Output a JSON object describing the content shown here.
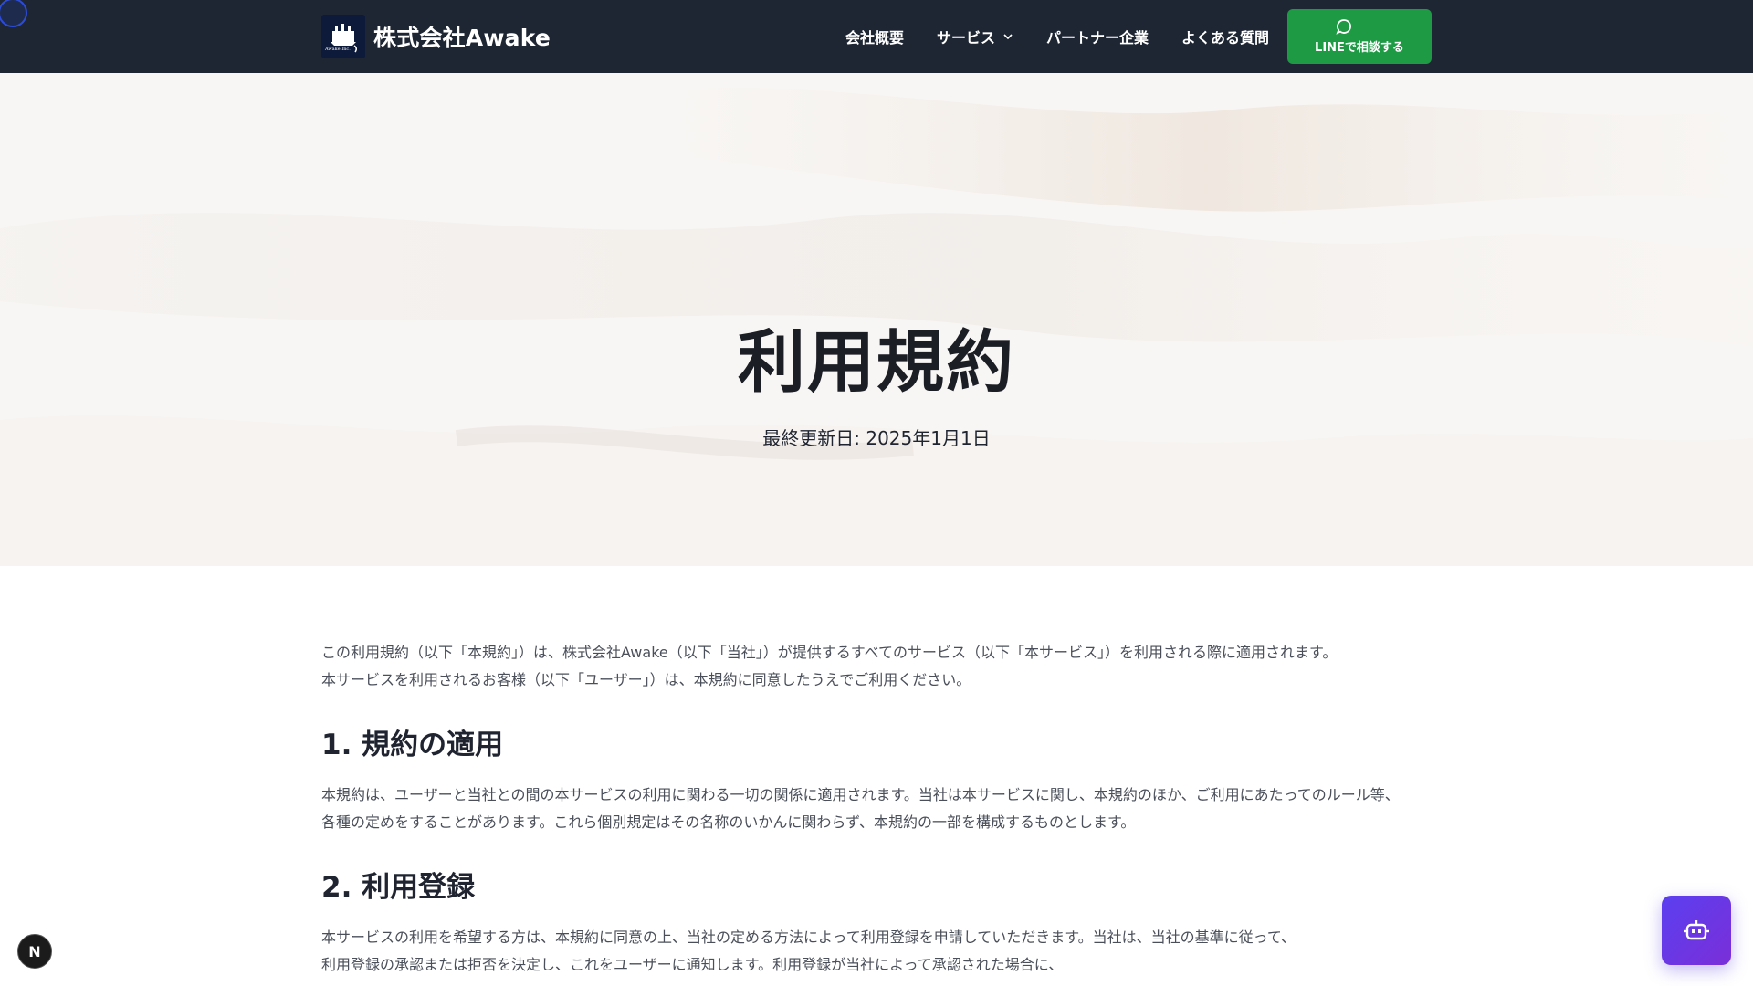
{
  "header": {
    "brand_name": "株式会社Awake",
    "logo_text": "Awake Inc.",
    "nav": [
      {
        "label": "会社概要"
      },
      {
        "label": "サービス"
      },
      {
        "label": "パートナー企業"
      },
      {
        "label": "よくある質問"
      }
    ],
    "cta_label": "LINEで相談する"
  },
  "hero": {
    "title": "利用規約",
    "updated": "最終更新日: 2025年1月1日"
  },
  "content": {
    "intro": [
      "この利用規約（以下「本規約」）は、株式会社Awake（以下「当社」）が提供するすべてのサービス（以下「本サービス」）を利用される際に適用されます。",
      "本サービスを利用されるお客様（以下「ユーザー」）は、本規約に同意したうえでご利用ください。"
    ],
    "sections": [
      {
        "heading": "1. 規約の適用",
        "lines": [
          "本規約は、ユーザーと当社との間の本サービスの利用に関わる一切の関係に適用されます。当社は本サービスに関し、本規約のほか、ご利用にあたってのルール等、",
          "各種の定めをすることがあります。これら個別規定はその名称のいかんに関わらず、本規約の一部を構成するものとします。"
        ]
      },
      {
        "heading": "2. 利用登録",
        "lines": [
          "本サービスの利用を希望する方は、本規約に同意の上、当社の定める方法によって利用登録を申請していただきます。当社は、当社の基準に従って、",
          "利用登録の承認または拒否を決定し、これをユーザーに通知します。利用登録が当社によって承認された場合に、"
        ]
      }
    ]
  },
  "floating": {
    "n_badge": "N"
  },
  "icons": {
    "chevron": "chevron-down-icon",
    "line": "chat-bubble-icon",
    "bot": "robot-icon",
    "logo": "ship-logo-icon"
  },
  "colors": {
    "header_bg": "#1e2633",
    "cta_green": "#1e9a45",
    "bot_purple": "#6a36e6"
  }
}
